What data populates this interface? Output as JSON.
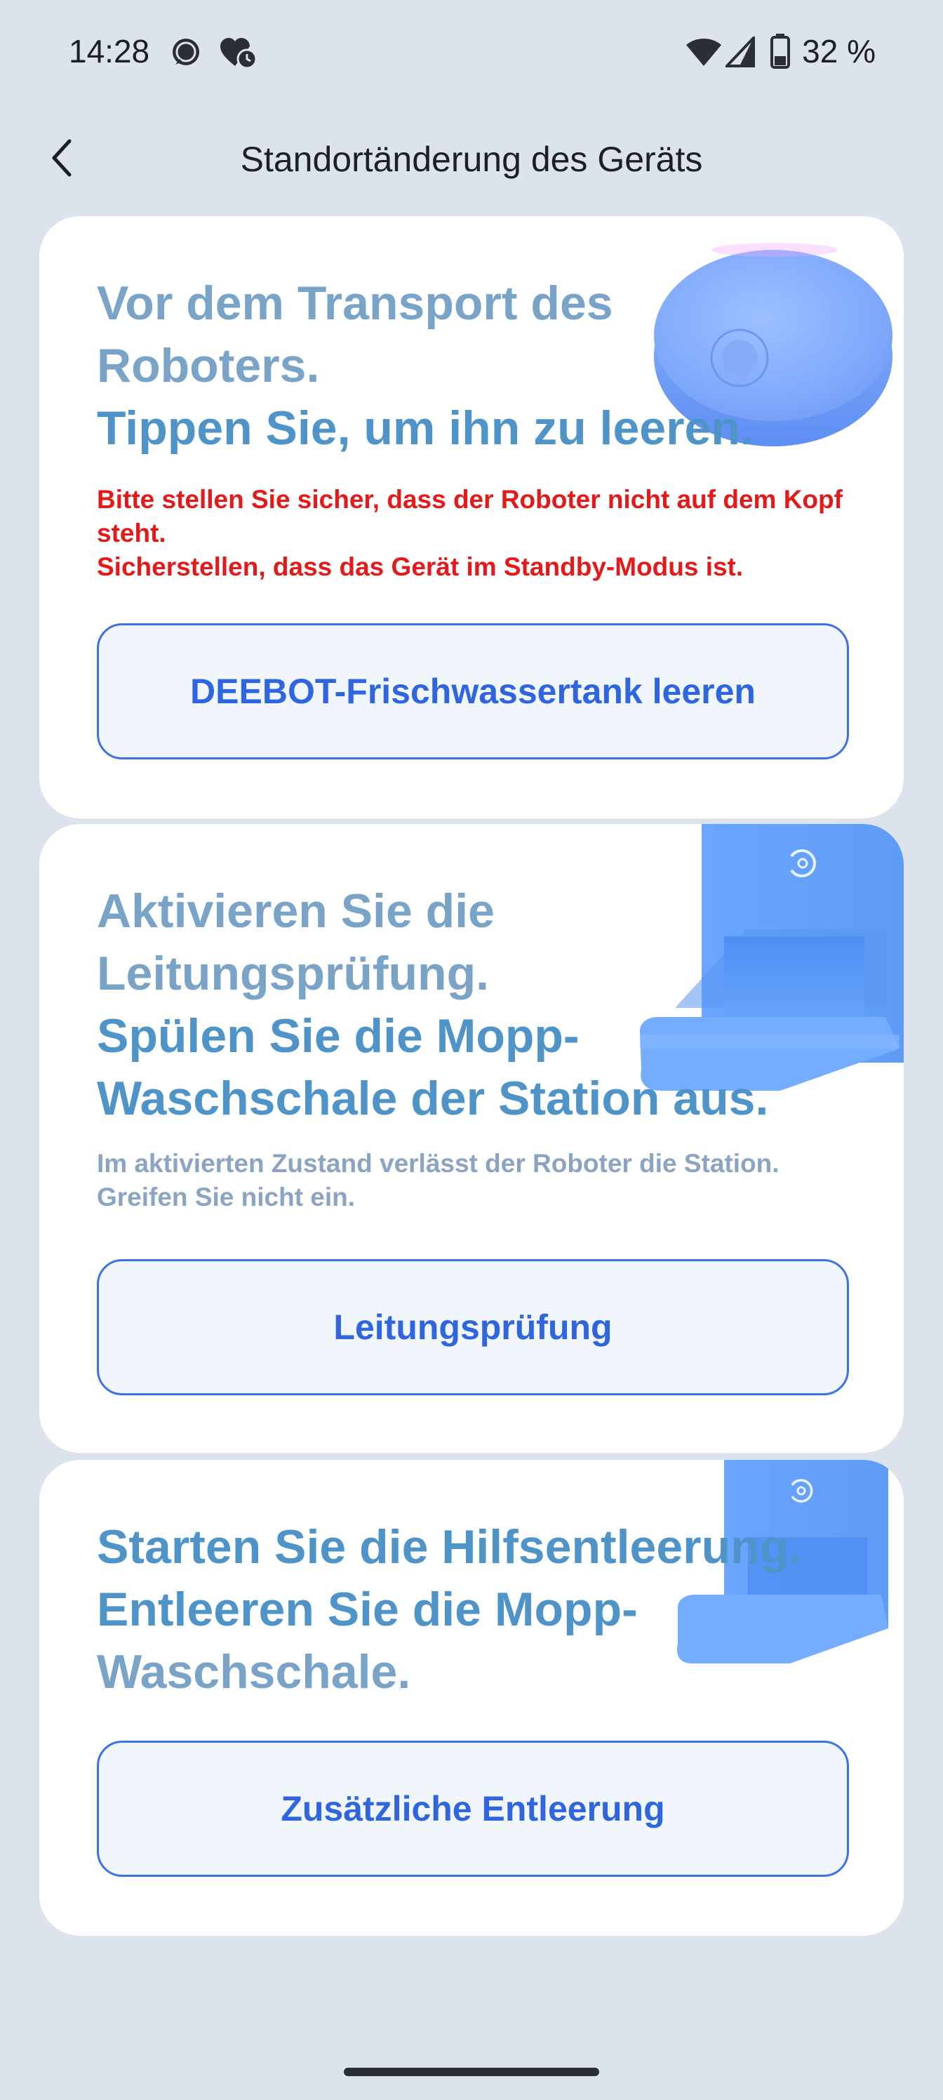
{
  "status_bar": {
    "time": "14:28",
    "battery": "32 %",
    "icons": [
      "chat-bubble-icon",
      "heart-clock-icon",
      "wifi-icon",
      "cell-signal-icon",
      "battery-icon"
    ]
  },
  "app_bar": {
    "back_icon": "chevron-left-icon",
    "title": "Standortänderung des Geräts"
  },
  "cards": [
    {
      "heading_lines": [
        "Vor dem Transport des",
        "Roboters.",
        "Tippen Sie, um ihn zu leeren."
      ],
      "warning_lines": [
        "Bitte stellen Sie sicher, dass der Roboter nicht auf dem Kopf steht.",
        "Sicherstellen, dass das Gerät im Standby-Modus ist."
      ],
      "button_label": "DEEBOT-Frischwassertank leeren",
      "illustration": "robot-vacuum-illustration"
    },
    {
      "heading_lines": [
        "Aktivieren Sie die",
        "Leitungsprüfung.",
        "Spülen Sie die Mopp-",
        "Waschschale der Station aus."
      ],
      "note": "Im aktivierten Zustand verlässt der Roboter die Station. Greifen Sie nicht ein.",
      "button_label": "Leitungsprüfung",
      "illustration": "station-illustration"
    },
    {
      "heading_lines": [
        "Starten Sie die Hilfsentleerung.",
        "Entleeren Sie die Mopp-",
        "Waschschale."
      ],
      "button_label": "Zusätzliche Entleerung",
      "illustration": "station-illustration"
    }
  ],
  "colors": {
    "background": "#dde3ec",
    "card": "#ffffff",
    "heading": "#7aa3c8",
    "warning": "#e41a1a",
    "note": "#8aa4c2",
    "button_border": "#3b72e6",
    "button_text": "#2f66e0",
    "button_fill": "#f1f6fd"
  }
}
